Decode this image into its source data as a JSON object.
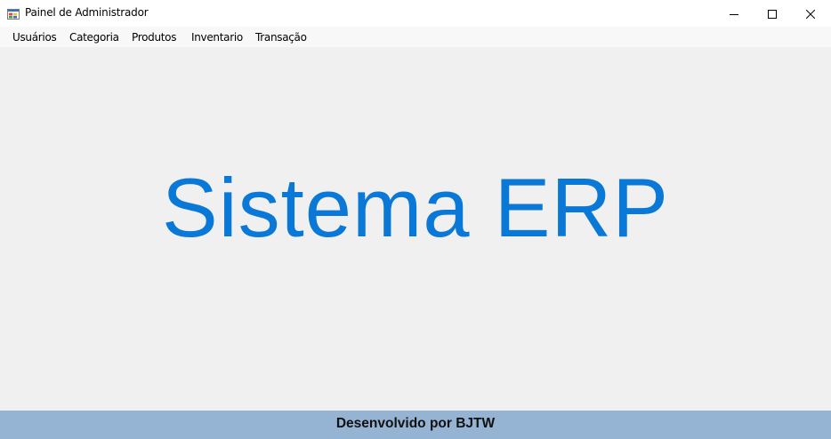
{
  "window": {
    "title": "Painel de Administrador",
    "app_icon": "form-icon",
    "controls": {
      "minimize_icon": "minimize-icon",
      "maximize_icon": "maximize-icon",
      "close_icon": "close-icon"
    }
  },
  "menubar": {
    "items": [
      {
        "label": "Usuários"
      },
      {
        "label": "Categoria"
      },
      {
        "label": "Produtos"
      },
      {
        "label": "Inventario"
      },
      {
        "label": "Transação"
      }
    ]
  },
  "main": {
    "heading": "Sistema ERP",
    "heading_color": "#0a78d7"
  },
  "footer": {
    "text": "Desenvolvido por BJTW",
    "background": "#95b3d3"
  }
}
